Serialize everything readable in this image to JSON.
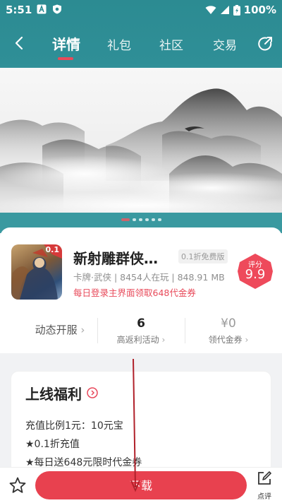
{
  "status": {
    "time": "5:51",
    "battery": "100%"
  },
  "nav": {
    "tabs": [
      "详情",
      "礼包",
      "社区",
      "交易"
    ]
  },
  "app": {
    "title": "新射雕群侠…",
    "badge": "0.1折免费版",
    "meta": "卡牌·武侠 | 8454人在玩 | 848.91 MB",
    "promo": "每日登录主界面领取648代金券",
    "icon_text": "0.1",
    "score_label": "评分",
    "score": "9.9"
  },
  "stats": {
    "open_label": "动态开服",
    "rebate_value": "6",
    "rebate_label": "高返利活动",
    "voucher_value": "¥0",
    "voucher_label": "领代金券"
  },
  "welfare": {
    "title": "上线福利",
    "lines": [
      "充值比例1元：10元宝",
      "★0.1折充值",
      "★每日送648元限时代金券"
    ]
  },
  "bottom": {
    "download": "下载",
    "review": "点评"
  },
  "colors": {
    "teal": "#2f8f97",
    "accent": "#e8414f"
  }
}
